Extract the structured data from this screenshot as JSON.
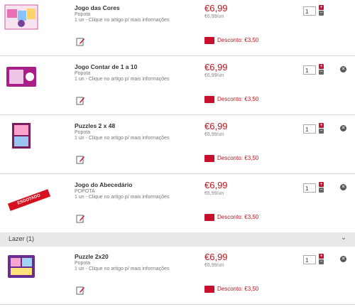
{
  "products": [
    {
      "title": "Jogo das Cores",
      "brand": "Popota",
      "sub": "1 un - Clique no artigo p/ mais informações",
      "price": "€6,99",
      "unit": "€6,99/un",
      "discount": "Desconto: €3,50",
      "qty": "1"
    },
    {
      "title": "Jogo Contar de 1 a 10",
      "brand": "Popota",
      "sub": "1 un - Clique no artigo p/ mais informações",
      "price": "€6,99",
      "unit": "€6,99/un",
      "discount": "Desconto: €3,50",
      "qty": "1"
    },
    {
      "title": "Puzzles 2 x 48",
      "brand": "Popota",
      "sub": "1 un - Clique no artigo p/ mais informações",
      "price": "€6,99",
      "unit": "€6,99/un",
      "discount": "Desconto: €3,50",
      "qty": "1"
    },
    {
      "title": "Jogo do Abecedário",
      "brand": "POPOTA",
      "sub": "1 un - Clique no artigo p/ mais informações",
      "price": "€6,99",
      "unit": "€6,99/un",
      "discount": "Desconto: €3,50",
      "qty": "1",
      "badge": "ESGOTADO"
    },
    {
      "title": "Puzzle 2x20",
      "brand": "Popota",
      "sub": "1 un - Clique no artigo p/ mais informações",
      "price": "€6,99",
      "unit": "€6,99/un",
      "discount": "Desconto: €3,50",
      "qty": "1"
    }
  ],
  "section": {
    "label": "Lazer (1)"
  },
  "colors": {
    "accent": "#c0161e",
    "discount_tag": "#c8102e",
    "section_bg": "#e8e8e8"
  }
}
